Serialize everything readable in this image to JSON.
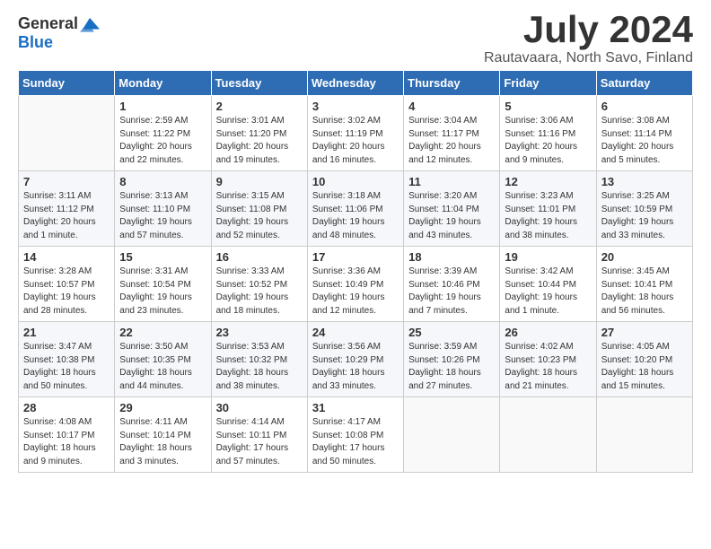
{
  "header": {
    "logo_general": "General",
    "logo_blue": "Blue",
    "title": "July 2024",
    "location": "Rautavaara, North Savo, Finland"
  },
  "days_of_week": [
    "Sunday",
    "Monday",
    "Tuesday",
    "Wednesday",
    "Thursday",
    "Friday",
    "Saturday"
  ],
  "weeks": [
    [
      {
        "day": "",
        "info": ""
      },
      {
        "day": "1",
        "info": "Sunrise: 2:59 AM\nSunset: 11:22 PM\nDaylight: 20 hours\nand 22 minutes."
      },
      {
        "day": "2",
        "info": "Sunrise: 3:01 AM\nSunset: 11:20 PM\nDaylight: 20 hours\nand 19 minutes."
      },
      {
        "day": "3",
        "info": "Sunrise: 3:02 AM\nSunset: 11:19 PM\nDaylight: 20 hours\nand 16 minutes."
      },
      {
        "day": "4",
        "info": "Sunrise: 3:04 AM\nSunset: 11:17 PM\nDaylight: 20 hours\nand 12 minutes."
      },
      {
        "day": "5",
        "info": "Sunrise: 3:06 AM\nSunset: 11:16 PM\nDaylight: 20 hours\nand 9 minutes."
      },
      {
        "day": "6",
        "info": "Sunrise: 3:08 AM\nSunset: 11:14 PM\nDaylight: 20 hours\nand 5 minutes."
      }
    ],
    [
      {
        "day": "7",
        "info": "Sunrise: 3:11 AM\nSunset: 11:12 PM\nDaylight: 20 hours\nand 1 minute."
      },
      {
        "day": "8",
        "info": "Sunrise: 3:13 AM\nSunset: 11:10 PM\nDaylight: 19 hours\nand 57 minutes."
      },
      {
        "day": "9",
        "info": "Sunrise: 3:15 AM\nSunset: 11:08 PM\nDaylight: 19 hours\nand 52 minutes."
      },
      {
        "day": "10",
        "info": "Sunrise: 3:18 AM\nSunset: 11:06 PM\nDaylight: 19 hours\nand 48 minutes."
      },
      {
        "day": "11",
        "info": "Sunrise: 3:20 AM\nSunset: 11:04 PM\nDaylight: 19 hours\nand 43 minutes."
      },
      {
        "day": "12",
        "info": "Sunrise: 3:23 AM\nSunset: 11:01 PM\nDaylight: 19 hours\nand 38 minutes."
      },
      {
        "day": "13",
        "info": "Sunrise: 3:25 AM\nSunset: 10:59 PM\nDaylight: 19 hours\nand 33 minutes."
      }
    ],
    [
      {
        "day": "14",
        "info": "Sunrise: 3:28 AM\nSunset: 10:57 PM\nDaylight: 19 hours\nand 28 minutes."
      },
      {
        "day": "15",
        "info": "Sunrise: 3:31 AM\nSunset: 10:54 PM\nDaylight: 19 hours\nand 23 minutes."
      },
      {
        "day": "16",
        "info": "Sunrise: 3:33 AM\nSunset: 10:52 PM\nDaylight: 19 hours\nand 18 minutes."
      },
      {
        "day": "17",
        "info": "Sunrise: 3:36 AM\nSunset: 10:49 PM\nDaylight: 19 hours\nand 12 minutes."
      },
      {
        "day": "18",
        "info": "Sunrise: 3:39 AM\nSunset: 10:46 PM\nDaylight: 19 hours\nand 7 minutes."
      },
      {
        "day": "19",
        "info": "Sunrise: 3:42 AM\nSunset: 10:44 PM\nDaylight: 19 hours\nand 1 minute."
      },
      {
        "day": "20",
        "info": "Sunrise: 3:45 AM\nSunset: 10:41 PM\nDaylight: 18 hours\nand 56 minutes."
      }
    ],
    [
      {
        "day": "21",
        "info": "Sunrise: 3:47 AM\nSunset: 10:38 PM\nDaylight: 18 hours\nand 50 minutes."
      },
      {
        "day": "22",
        "info": "Sunrise: 3:50 AM\nSunset: 10:35 PM\nDaylight: 18 hours\nand 44 minutes."
      },
      {
        "day": "23",
        "info": "Sunrise: 3:53 AM\nSunset: 10:32 PM\nDaylight: 18 hours\nand 38 minutes."
      },
      {
        "day": "24",
        "info": "Sunrise: 3:56 AM\nSunset: 10:29 PM\nDaylight: 18 hours\nand 33 minutes."
      },
      {
        "day": "25",
        "info": "Sunrise: 3:59 AM\nSunset: 10:26 PM\nDaylight: 18 hours\nand 27 minutes."
      },
      {
        "day": "26",
        "info": "Sunrise: 4:02 AM\nSunset: 10:23 PM\nDaylight: 18 hours\nand 21 minutes."
      },
      {
        "day": "27",
        "info": "Sunrise: 4:05 AM\nSunset: 10:20 PM\nDaylight: 18 hours\nand 15 minutes."
      }
    ],
    [
      {
        "day": "28",
        "info": "Sunrise: 4:08 AM\nSunset: 10:17 PM\nDaylight: 18 hours\nand 9 minutes."
      },
      {
        "day": "29",
        "info": "Sunrise: 4:11 AM\nSunset: 10:14 PM\nDaylight: 18 hours\nand 3 minutes."
      },
      {
        "day": "30",
        "info": "Sunrise: 4:14 AM\nSunset: 10:11 PM\nDaylight: 17 hours\nand 57 minutes."
      },
      {
        "day": "31",
        "info": "Sunrise: 4:17 AM\nSunset: 10:08 PM\nDaylight: 17 hours\nand 50 minutes."
      },
      {
        "day": "",
        "info": ""
      },
      {
        "day": "",
        "info": ""
      },
      {
        "day": "",
        "info": ""
      }
    ]
  ]
}
